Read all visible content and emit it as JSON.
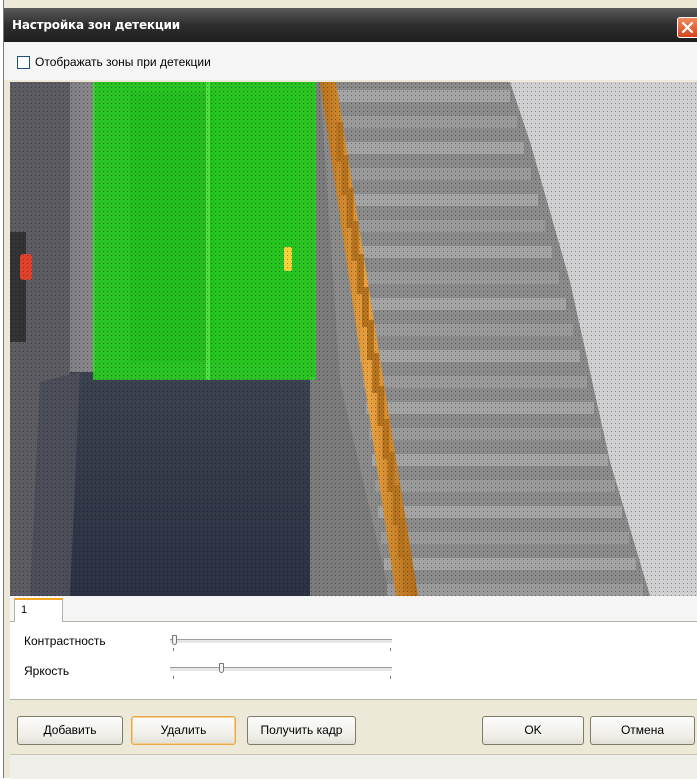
{
  "window": {
    "title": "Настройка зон детекции"
  },
  "options": {
    "show_zones_label": "Отображать зоны при детекции",
    "show_zones_checked": false
  },
  "tabs": [
    {
      "label": "1",
      "active": true
    }
  ],
  "sliders": {
    "contrast": {
      "label": "Контрастность",
      "value_fraction": 0.01
    },
    "brightness": {
      "label": "Яркость",
      "value_fraction": 0.22
    }
  },
  "buttons": {
    "add": "Добавить",
    "delete": "Удалить",
    "get_frame": "Получить кадр",
    "ok": "OK",
    "cancel": "Отмена"
  },
  "colors": {
    "zone_fill": "#29e01f",
    "titlebar": "#2e2e2e",
    "close_button": "#e05a2a",
    "focus_border": "#e8a64b"
  }
}
